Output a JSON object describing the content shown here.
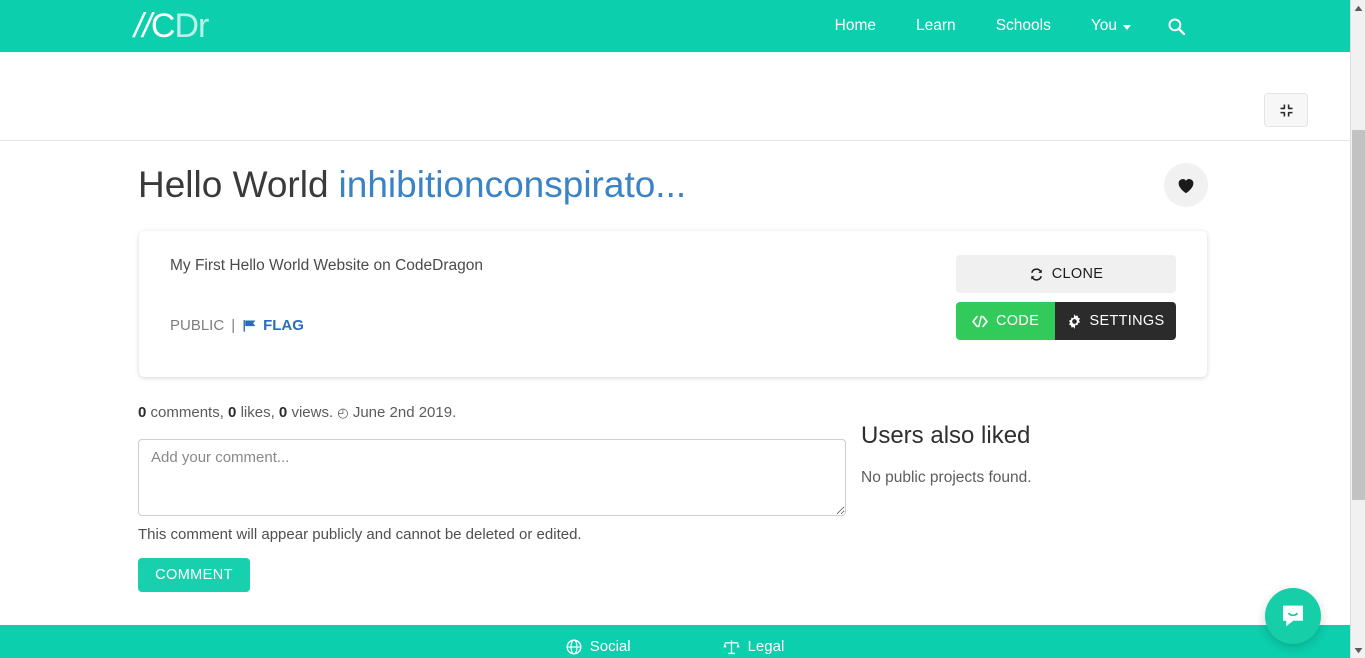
{
  "navbar": {
    "brand": {
      "slash": "//",
      "c": "C",
      "dr": "Dr"
    },
    "links": [
      {
        "label": "Home",
        "name": "nav-home"
      },
      {
        "label": "Learn",
        "name": "nav-learn"
      },
      {
        "label": "Schools",
        "name": "nav-schools"
      },
      {
        "label": "You",
        "name": "nav-you",
        "has_caret": true
      }
    ],
    "search_icon": "search-icon",
    "background": "#0ccfad"
  },
  "subbar": {
    "fullscreen_icon": "compress-icon"
  },
  "project": {
    "title": "Hello World",
    "owner": "inhibitionconspirato...",
    "description": "My First Hello World Website on CodeDragon",
    "visibility": "PUBLIC",
    "separator": "|",
    "flag_label": "FLAG",
    "like_icon": "heart-icon",
    "actions": {
      "clone": "CLONE",
      "code": "CODE",
      "settings": "SETTINGS"
    }
  },
  "stats": {
    "comments_count": "0",
    "comments_label": "comments,",
    "likes_count": "0",
    "likes_label": "likes,",
    "views_count": "0",
    "views_label": "views.",
    "date": "June 2nd 2019."
  },
  "comment": {
    "placeholder": "Add your comment...",
    "note": "This comment will appear publicly and cannot be deleted or edited.",
    "submit_label": "COMMENT"
  },
  "sidebar": {
    "title": "Users also liked",
    "empty_text": "No public projects found."
  },
  "footer": {
    "items": [
      {
        "label": "Social",
        "icon": "globe-icon"
      },
      {
        "label": "Legal",
        "icon": "balance-icon"
      }
    ]
  },
  "chat": {
    "icon": "chat-bubble-icon"
  },
  "colors": {
    "teal": "#0ccfad",
    "green": "#32cb5b",
    "dark": "#2b2b2b",
    "link_blue": "#3a83c4",
    "flag_blue": "#2a6ebb",
    "comment_teal": "#18cfae"
  }
}
